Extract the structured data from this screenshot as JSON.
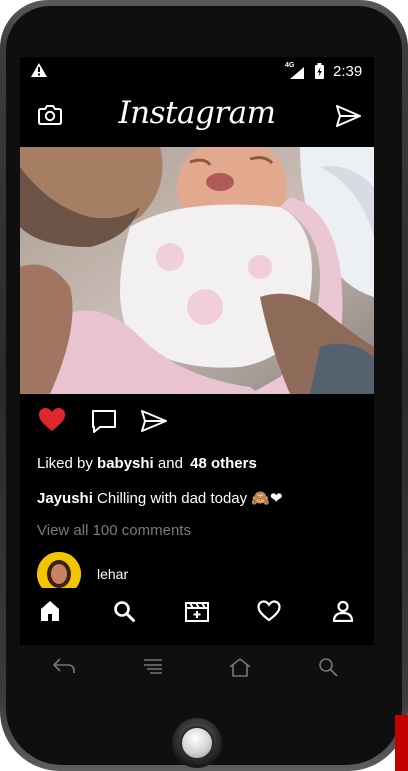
{
  "status_bar": {
    "network": "4G",
    "time": "2:39"
  },
  "header": {
    "title": "Instagram",
    "camera_icon": "camera-icon",
    "direct_icon": "send-icon"
  },
  "post": {
    "liked_by_prefix": "Liked by",
    "liked_by_user": "babyshi",
    "liked_by_and": "and",
    "liked_by_others": "48 others",
    "caption_user": "Jayushi",
    "caption_text": "Chilling with dad today 🙈❤",
    "view_all_comments": "View all 100 comments",
    "comment_user": "lehar"
  },
  "actions": {
    "like": "heart-filled-icon",
    "comment": "comment-icon",
    "share": "send-icon"
  },
  "bottom_nav": [
    "home-icon",
    "search-icon",
    "reels-icon",
    "heart-icon",
    "profile-icon"
  ],
  "colors": {
    "like": "#e0262d",
    "bg": "#000000",
    "muted": "#7a7a7a",
    "avatar_ring": "#f4c400"
  }
}
